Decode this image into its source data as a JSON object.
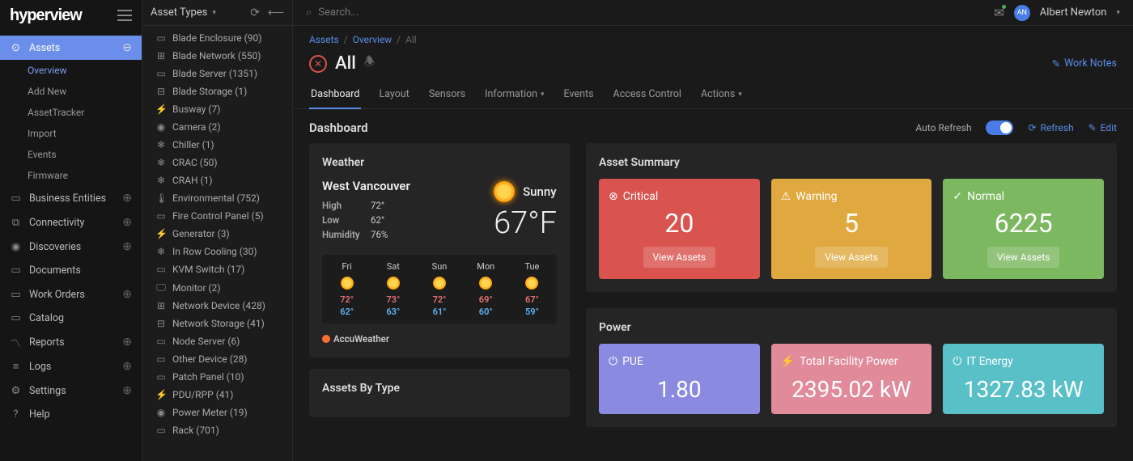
{
  "brand": "hyperview",
  "sidebar": {
    "assets": {
      "label": "Assets",
      "subs": [
        "Overview",
        "Add New",
        "AssetTracker",
        "Import",
        "Events",
        "Firmware"
      ],
      "active_sub": 0
    },
    "items": [
      {
        "label": "Business Entities",
        "icon": "briefcase"
      },
      {
        "label": "Connectivity",
        "icon": "link"
      },
      {
        "label": "Discoveries",
        "icon": "eye"
      },
      {
        "label": "Documents",
        "icon": "folder"
      },
      {
        "label": "Work Orders",
        "icon": "clipboard"
      },
      {
        "label": "Catalog",
        "icon": "book"
      },
      {
        "label": "Reports",
        "icon": "chart"
      },
      {
        "label": "Logs",
        "icon": "list"
      },
      {
        "label": "Settings",
        "icon": "gear"
      },
      {
        "label": "Help",
        "icon": "help"
      }
    ]
  },
  "asset_types": {
    "title": "Asset Types",
    "items": [
      {
        "label": "Blade Enclosure (90)",
        "icon": "▭"
      },
      {
        "label": "Blade Network (550)",
        "icon": "⊞"
      },
      {
        "label": "Blade Server (1351)",
        "icon": "▭"
      },
      {
        "label": "Blade Storage (1)",
        "icon": "⊟"
      },
      {
        "label": "Busway (7)",
        "icon": "⚡"
      },
      {
        "label": "Camera (2)",
        "icon": "◉"
      },
      {
        "label": "Chiller (1)",
        "icon": "❄"
      },
      {
        "label": "CRAC (50)",
        "icon": "❄"
      },
      {
        "label": "CRAH (1)",
        "icon": "❄"
      },
      {
        "label": "Environmental (752)",
        "icon": "🌡"
      },
      {
        "label": "Fire Control Panel (5)",
        "icon": "▭"
      },
      {
        "label": "Generator (3)",
        "icon": "⚡"
      },
      {
        "label": "In Row Cooling (30)",
        "icon": "❄"
      },
      {
        "label": "KVM Switch (17)",
        "icon": "▭"
      },
      {
        "label": "Monitor (2)",
        "icon": "🖵"
      },
      {
        "label": "Network Device (428)",
        "icon": "⊞"
      },
      {
        "label": "Network Storage (41)",
        "icon": "⊟"
      },
      {
        "label": "Node Server (6)",
        "icon": "▭"
      },
      {
        "label": "Other Device (28)",
        "icon": "▭"
      },
      {
        "label": "Patch Panel (10)",
        "icon": "▭"
      },
      {
        "label": "PDU/RPP (41)",
        "icon": "⚡"
      },
      {
        "label": "Power Meter (19)",
        "icon": "◉"
      },
      {
        "label": "Rack (701)",
        "icon": "▭"
      }
    ]
  },
  "topbar": {
    "search_placeholder": "Search...",
    "user_initials": "AN",
    "user_name": "Albert Newton"
  },
  "breadcrumbs": {
    "a": "Assets",
    "b": "Overview",
    "c": "All"
  },
  "page_title": "All",
  "work_notes": "Work Notes",
  "tabs": [
    "Dashboard",
    "Layout",
    "Sensors",
    "Information",
    "Events",
    "Access Control",
    "Actions"
  ],
  "tabs_with_chevron": [
    3,
    6
  ],
  "dashboard": {
    "title": "Dashboard",
    "auto_refresh": "Auto Refresh",
    "refresh": "Refresh",
    "edit": "Edit"
  },
  "weather": {
    "title": "Weather",
    "city": "West Vancouver",
    "condition": "Sunny",
    "temp": "67°F",
    "high_l": "High",
    "high": "72°",
    "low_l": "Low",
    "low": "62°",
    "hum_l": "Humidity",
    "hum": "76%",
    "forecast": [
      {
        "d": "Fri",
        "hi": "72°",
        "lo": "62°"
      },
      {
        "d": "Sat",
        "hi": "73°",
        "lo": "63°"
      },
      {
        "d": "Sun",
        "hi": "72°",
        "lo": "61°"
      },
      {
        "d": "Mon",
        "hi": "69°",
        "lo": "60°"
      },
      {
        "d": "Tue",
        "hi": "67°",
        "lo": "59°"
      }
    ],
    "provider": "AccuWeather"
  },
  "assets_by_type": {
    "title": "Assets By Type"
  },
  "summary": {
    "title": "Asset Summary",
    "critical_l": "Critical",
    "critical": "20",
    "warning_l": "Warning",
    "warning": "5",
    "normal_l": "Normal",
    "normal": "6225",
    "view": "View Assets"
  },
  "power": {
    "title": "Power",
    "pue_l": "PUE",
    "pue": "1.80",
    "tfp_l": "Total Facility Power",
    "tfp": "2395.02 kW",
    "ite_l": "IT Energy",
    "ite": "1327.83 kW"
  }
}
